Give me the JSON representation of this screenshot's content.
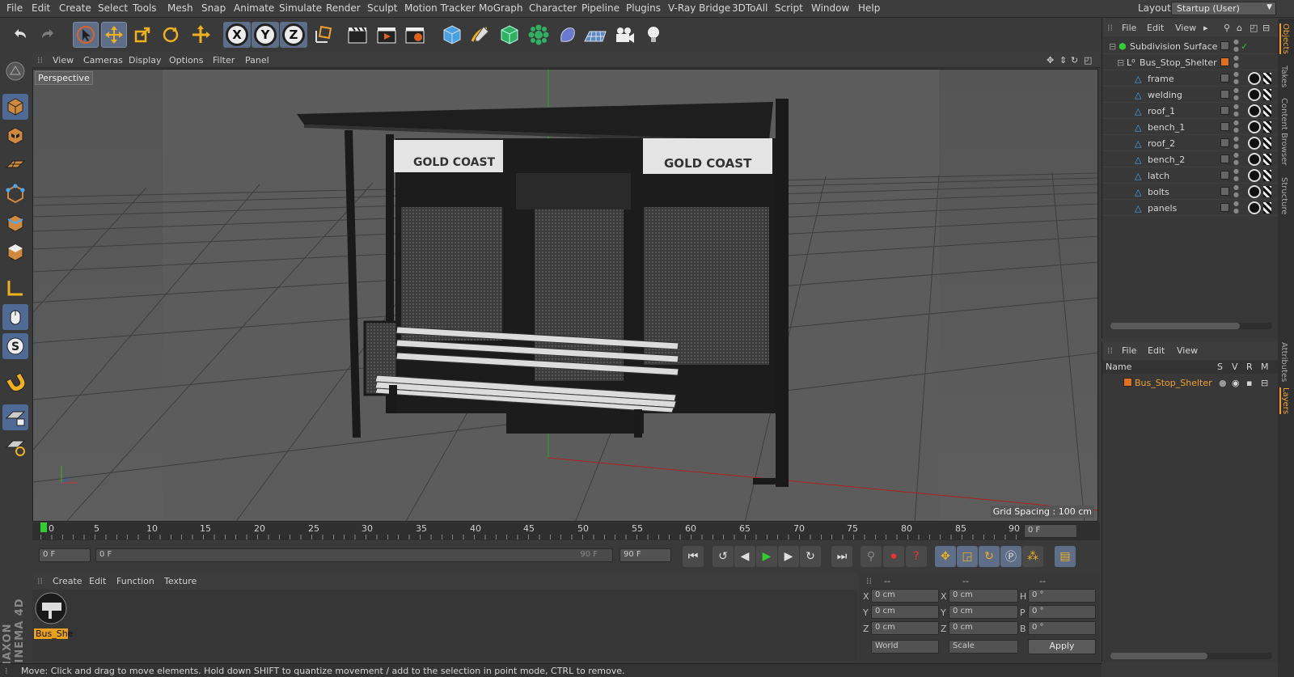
{
  "menubar": {
    "items": [
      "File",
      "Edit",
      "Create",
      "Select",
      "Tools",
      "Mesh",
      "Snap",
      "Animate",
      "Simulate",
      "Render",
      "Sculpt",
      "Motion Tracker",
      "MoGraph",
      "Character",
      "Pipeline",
      "Plugins",
      "V-Ray Bridge",
      "3DToAll",
      "Script",
      "Window",
      "Help"
    ],
    "layout_label": "Layout:",
    "layout_value": "Startup (User)"
  },
  "toolbar": {
    "axis_x": "X",
    "axis_y": "Y",
    "axis_z": "Z"
  },
  "viewport": {
    "menu": [
      "View",
      "Cameras",
      "Display",
      "Options",
      "Filter",
      "Panel"
    ],
    "label": "Perspective",
    "grid_spacing": "Grid Spacing : 100 cm",
    "sign_text": "GOLD COAST"
  },
  "timeline": {
    "ticks": [
      "0",
      "5",
      "10",
      "15",
      "20",
      "25",
      "30",
      "35",
      "40",
      "45",
      "50",
      "55",
      "60",
      "65",
      "70",
      "75",
      "80",
      "85",
      "90"
    ],
    "frame_field": "0 F",
    "current_frame": "0 F",
    "start_field": "0 F",
    "range_start": "0 F",
    "range_end": "90 F",
    "end_field": "90 F"
  },
  "material": {
    "menu": [
      "Create",
      "Edit",
      "Function",
      "Texture"
    ],
    "name": "Bus_She"
  },
  "coords": {
    "headers": [
      "--",
      "--",
      "--"
    ],
    "rows": [
      {
        "a": "X",
        "av": "0 cm",
        "b": "X",
        "bv": "0 cm",
        "c": "H",
        "cv": "0 °"
      },
      {
        "a": "Y",
        "av": "0 cm",
        "b": "Y",
        "bv": "0 cm",
        "c": "P",
        "cv": "0 °"
      },
      {
        "a": "Z",
        "av": "0 cm",
        "b": "Z",
        "bv": "0 cm",
        "c": "B",
        "cv": "0 °"
      }
    ],
    "space": "World",
    "mode": "Scale",
    "apply": "Apply"
  },
  "status": "Move: Click and drag to move elements. Hold down SHIFT to quantize movement / add to the selection in point mode, CTRL to remove.",
  "brand": "MAXON CINEMA 4D",
  "objects": {
    "menu": [
      "File",
      "Edit",
      "View"
    ],
    "items": [
      {
        "name": "Subdivision Surface",
        "depth": 0
      },
      {
        "name": "Bus_Stop_Shelter",
        "depth": 1
      },
      {
        "name": "frame",
        "depth": 2
      },
      {
        "name": "welding",
        "depth": 2
      },
      {
        "name": "roof_1",
        "depth": 2
      },
      {
        "name": "bench_1",
        "depth": 2
      },
      {
        "name": "roof_2",
        "depth": 2
      },
      {
        "name": "bench_2",
        "depth": 2
      },
      {
        "name": "latch",
        "depth": 2
      },
      {
        "name": "bolts",
        "depth": 2
      },
      {
        "name": "panels",
        "depth": 2
      }
    ]
  },
  "layers": {
    "menu": [
      "File",
      "Edit",
      "View"
    ],
    "columns": [
      "Name",
      "S",
      "V",
      "R",
      "M"
    ],
    "items": [
      {
        "name": "Bus_Stop_Shelter"
      }
    ]
  },
  "right_tabs": [
    "Objects",
    "Takes",
    "Content Browser",
    "Structure",
    "Attributes",
    "Layers"
  ],
  "colors": {
    "accent": "#f0a030",
    "selection": "#5e6e88",
    "layer": "#e07020"
  }
}
